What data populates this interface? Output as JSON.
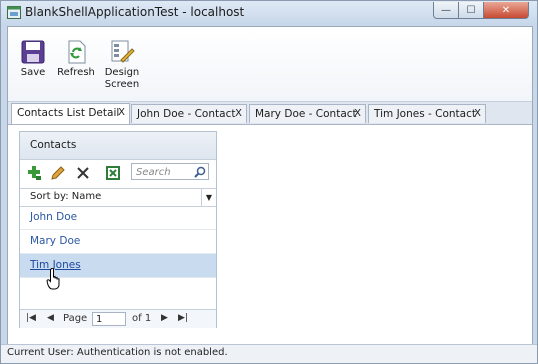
{
  "window": {
    "title": "BlankShellApplicationTest - localhost",
    "minimize_label": "—",
    "maximize_label": "☐",
    "close_label": "✕"
  },
  "ribbon": {
    "save_label": "Save",
    "refresh_label": "Refresh",
    "design_label_line1": "Design",
    "design_label_line2": "Screen"
  },
  "tabs": [
    {
      "label": "Contacts List Detail",
      "close": "X"
    },
    {
      "label": "John Doe - Contact",
      "close": "X"
    },
    {
      "label": "Mary Doe - Contact",
      "close": "X"
    },
    {
      "label": "Tim Jones - Contact",
      "close": "X"
    }
  ],
  "contacts_panel": {
    "title": "Contacts",
    "search_placeholder": "Search",
    "sort_label": "Sort by: Name",
    "items": [
      "John Doe",
      "Mary Doe",
      "Tim Jones"
    ],
    "selected_index": 2,
    "pager": {
      "page_label": "Page",
      "page_value": "1",
      "of_label": "of 1"
    }
  },
  "statusbar": {
    "text": "Current User: Authentication is not enabled."
  },
  "icons": {
    "app": "app-window-icon",
    "save": "floppy-disk-icon",
    "refresh": "refresh-icon",
    "design": "design-screen-icon",
    "add": "add-icon",
    "edit": "pencil-icon",
    "delete": "delete-icon",
    "excel": "excel-export-icon",
    "search": "search-icon"
  }
}
